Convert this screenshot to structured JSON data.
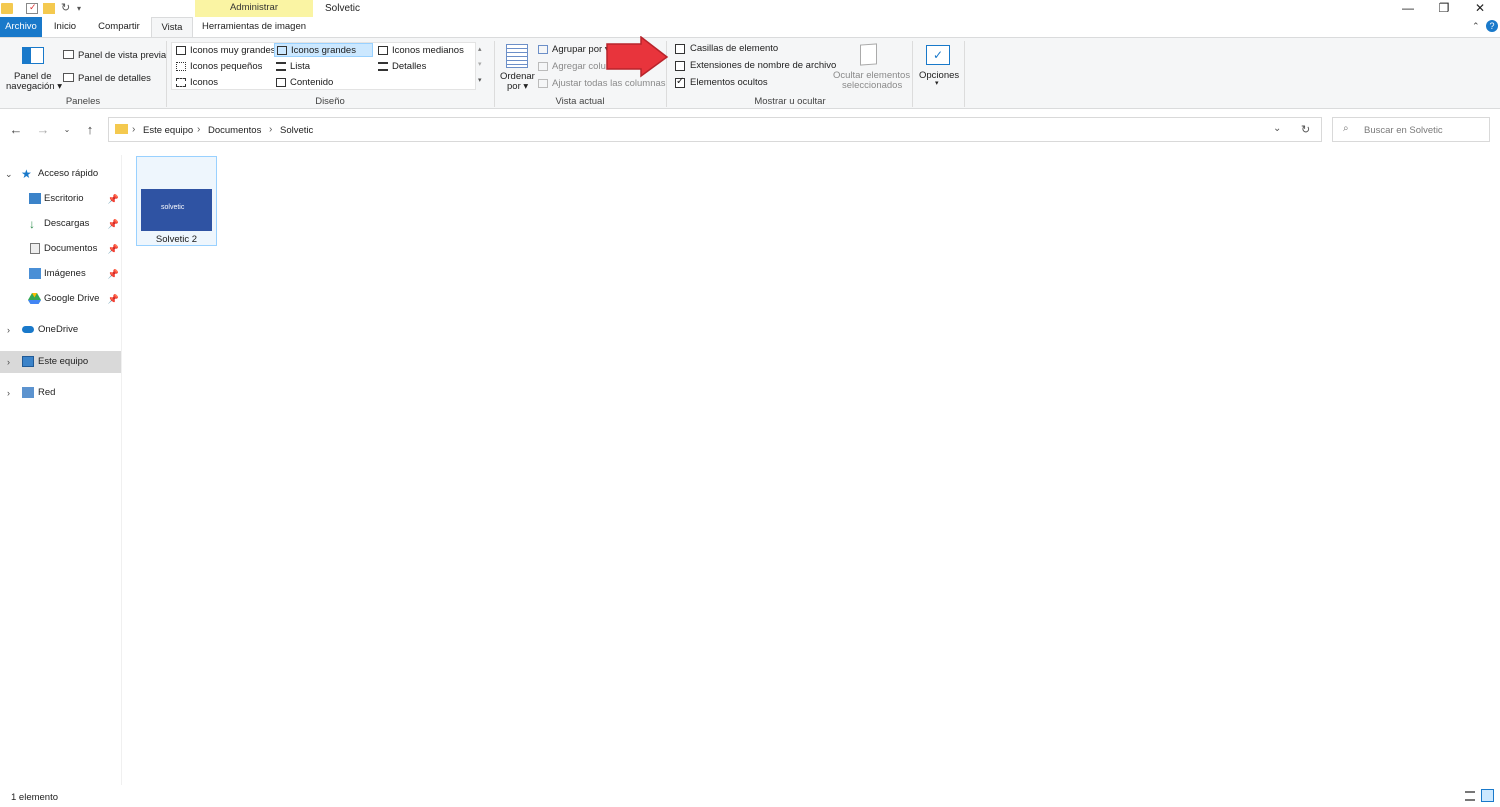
{
  "window": {
    "title": "Solvetic",
    "context_tab": "Administrar",
    "minimize": "—",
    "maximize": "❐",
    "close": "✕"
  },
  "tabs": {
    "archivo": "Archivo",
    "inicio": "Inicio",
    "compartir": "Compartir",
    "vista": "Vista",
    "herramientas": "Herramientas de imagen"
  },
  "ribbon": {
    "paneles": {
      "nav_pane_line1": "Panel de",
      "nav_pane_line2": "navegación",
      "preview_pane": "Panel de vista previa",
      "details_pane": "Panel de detalles",
      "label": "Paneles"
    },
    "diseno": {
      "items": [
        "Iconos muy grandes",
        "Iconos grandes",
        "Iconos medianos",
        "Iconos pequeños",
        "Lista",
        "Detalles",
        "Iconos",
        "Contenido"
      ],
      "selected": "Iconos grandes",
      "label": "Diseño"
    },
    "vista_actual": {
      "ordenar_line1": "Ordenar",
      "ordenar_line2": "por",
      "agrupar": "Agrupar por",
      "agregar": "Agregar columnas",
      "ajustar": "Ajustar todas las columnas",
      "label": "Vista actual"
    },
    "mostrar": {
      "casillas": "Casillas de elemento",
      "extensiones": "Extensiones de nombre de archivo",
      "ocultos": "Elementos ocultos",
      "casillas_checked": false,
      "extensiones_checked": false,
      "ocultos_checked": true,
      "ocultar_line1": "Ocultar elementos",
      "ocultar_line2": "seleccionados",
      "label": "Mostrar u ocultar"
    },
    "opciones": "Opciones"
  },
  "address": {
    "crumbs": [
      "Este equipo",
      "Documentos",
      "Solvetic"
    ],
    "search_placeholder": "Buscar en Solvetic"
  },
  "sidebar": {
    "quick_access": "Acceso rápido",
    "items": [
      "Escritorio",
      "Descargas",
      "Documentos",
      "Imágenes",
      "Google Drive"
    ],
    "onedrive": "OneDrive",
    "este_equipo": "Este equipo",
    "red": "Red"
  },
  "content": {
    "file_name": "Solvetic 2",
    "thumb_text": "solvetic"
  },
  "status": {
    "count": "1 elemento"
  },
  "colors": {
    "accent": "#1979ca",
    "context_tab": "#faf4a3",
    "selection": "#cce8ff",
    "arrow": "#e8343c"
  }
}
